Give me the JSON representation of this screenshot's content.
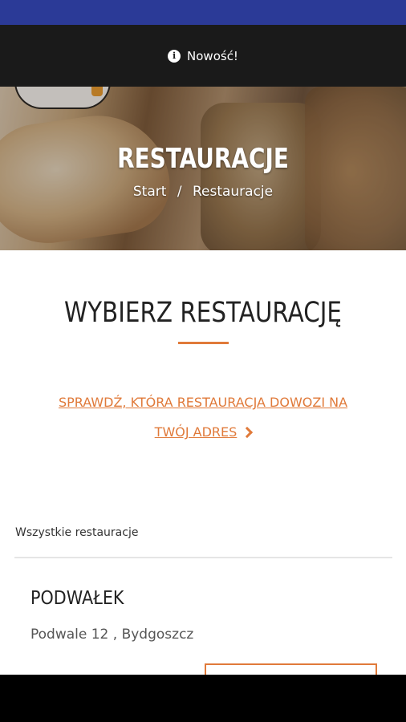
{
  "notice": {
    "text": "Nowość!",
    "icon": "info-icon"
  },
  "hero": {
    "title": "RESTAURACJE",
    "breadcrumb": {
      "home": "Start",
      "separator": "/",
      "current": "Restauracje"
    }
  },
  "section": {
    "title": "WYBIERZ RESTAURACJĘ",
    "check_link_line1": "SPRAWDŹ, KTÓRA RESTAURACJA DOWOZI NA",
    "check_link_line2": "TWÓJ ADRES",
    "check_link_icon": "chevron-right-icon"
  },
  "list": {
    "label": "Wszystkie restauracje",
    "restaurants": [
      {
        "name": "PODWAŁEK",
        "address": "Podwale 12 , Bydgoszcz"
      }
    ]
  },
  "colors": {
    "accent": "#e07a3a",
    "status_bar": "#2b3a97",
    "notice_bg": "#1a1a1a"
  }
}
